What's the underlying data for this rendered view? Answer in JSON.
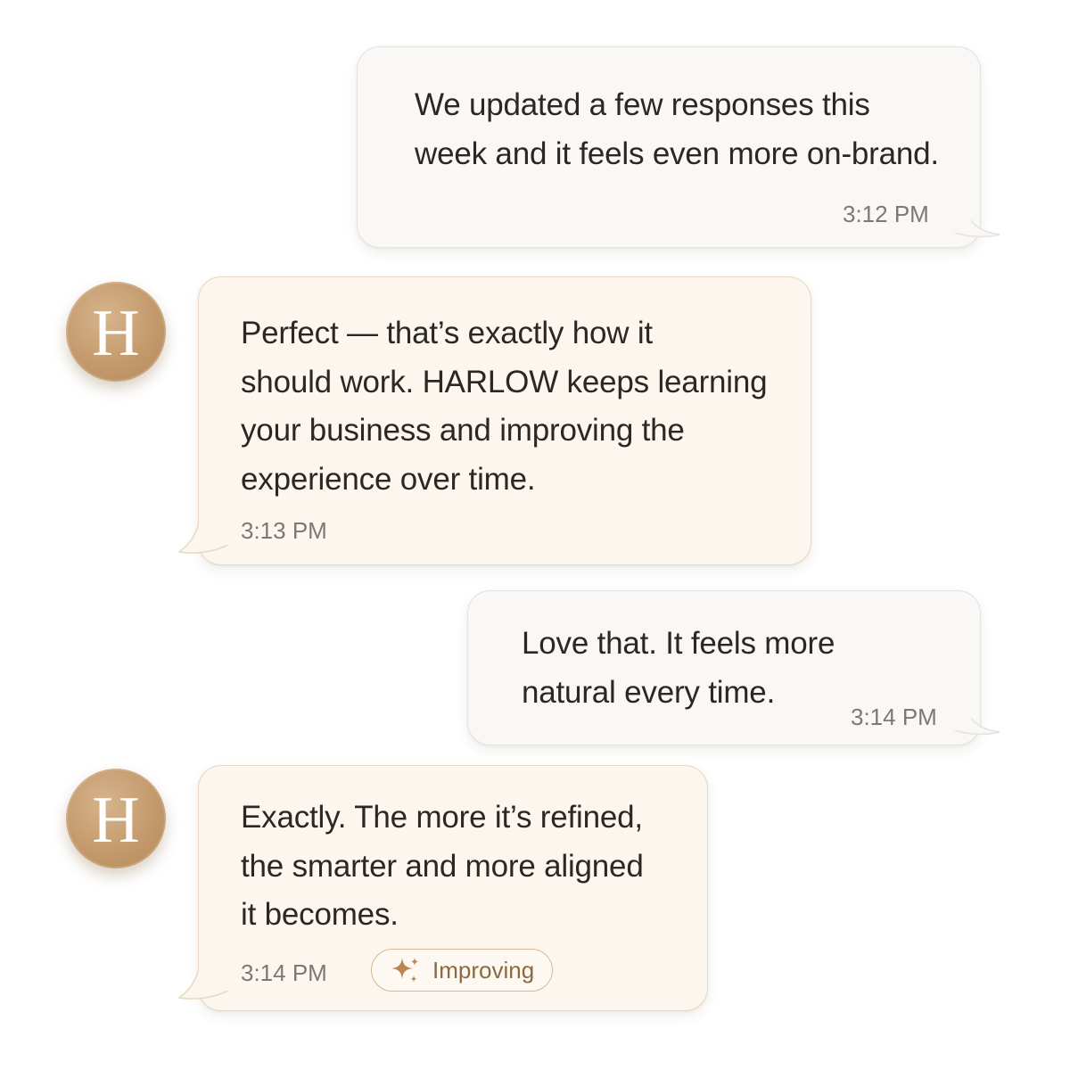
{
  "messages": [
    {
      "sender": "user",
      "text": "We updated a few responses this\nweek and it feels even more on-brand.",
      "time": "3:12 PM"
    },
    {
      "sender": "assistant",
      "avatar_letter": "H",
      "text": "Perfect — that’s exactly how it\nshould work. HARLOW keeps learning\nyour business and improving the\nexperience over time.",
      "time": "3:13 PM"
    },
    {
      "sender": "user",
      "text": "Love that. It feels more\nnatural every time.",
      "time": "3:14 PM"
    },
    {
      "sender": "assistant",
      "avatar_letter": "H",
      "text": "Exactly. The more it’s refined,\nthe smarter and more aligned\nit becomes.",
      "time": "3:14 PM",
      "badge": {
        "icon": "sparkle-icon",
        "label": "Improving"
      }
    }
  ],
  "colors": {
    "user_bubble": "#f9f8f6",
    "assistant_bubble": "#fcf6ef",
    "assistant_border": "#e8d8c3",
    "avatar": "#c49a6c",
    "badge_accent": "#b8864e"
  }
}
